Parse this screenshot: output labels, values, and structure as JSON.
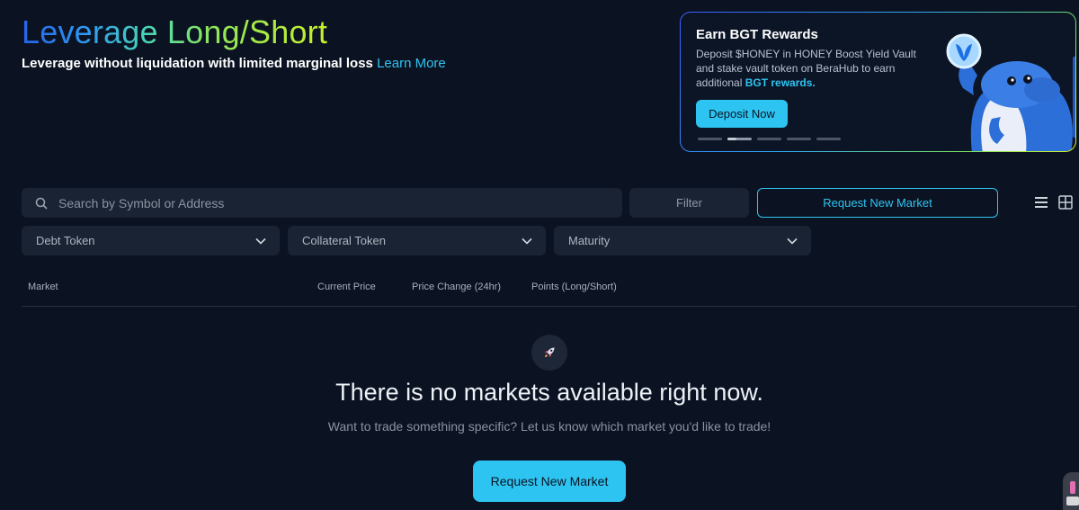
{
  "hero": {
    "title": "Leverage Long/Short",
    "subtitle": "Leverage without liquidation with limited marginal loss",
    "learn_more": "Learn More"
  },
  "promo": {
    "title": "Earn BGT Rewards",
    "body": "Deposit $HONEY in HONEY Boost Yield Vault and stake vault token on BeraHub to earn additional",
    "highlight": "BGT rewards.",
    "button": "Deposit Now",
    "carousel_total": 5,
    "carousel_active": 2
  },
  "controls": {
    "search_placeholder": "Search by Symbol or Address",
    "filter_label": "Filter",
    "request_label": "Request New Market",
    "dropdowns": {
      "debt": "Debt Token",
      "collateral": "Collateral Token",
      "maturity": "Maturity"
    }
  },
  "table": {
    "headers": [
      "Market",
      "Current Price",
      "Price Change (24hr)",
      "Points (Long/Short)"
    ]
  },
  "empty_state": {
    "icon": "rocket-icon",
    "title": "There is no markets available right now.",
    "subtitle": "Want to trade something specific? Let us know which market you'd like to trade!",
    "button": "Request New Market"
  },
  "colors": {
    "background": "#0b1322",
    "surface": "#1a2333",
    "accent": "#2ec4f1"
  }
}
